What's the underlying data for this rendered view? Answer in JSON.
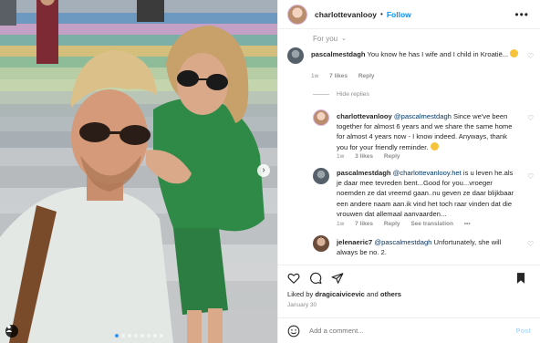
{
  "post": {
    "username": "charlottevanlooy",
    "separator": "•",
    "follow_label": "Follow",
    "more_label": "•••",
    "for_you_label": "For you",
    "image_alt": "selfie on colorful stairs",
    "carousel_dots": 8,
    "active_dot": 0
  },
  "comments": [
    {
      "username": "pascalmestdagh",
      "text": "You know he has I wife and I child in Kroatië...",
      "emoji": true,
      "time": "1w",
      "likes": "7 likes",
      "reply": "Reply"
    },
    {
      "username": "charlottevanlooy",
      "mention": "@pascalmestdagh",
      "text": "Since we've been together for almost 6 years and we share the same home for almost 4 years now - I know indeed. Anyways, thank you for your friendly reminder.",
      "emoji": true,
      "time": "1w",
      "likes": "3 likes",
      "reply": "Reply"
    },
    {
      "username": "pascalmestdagh",
      "mention": "@charlottevanlooy.het",
      "text": "is u leven he.als je daar mee tevreden bent...Good for you...vroeger noemden ze dat vreemd gaan..nu geven ze daar blijkbaar een andere naam aan.ik vind het toch raar vinden dat die vrouwen dat allemaal aanvaarden...",
      "time": "1w",
      "likes": "7 likes",
      "reply": "Reply",
      "translation": "See translation",
      "more": "•••"
    },
    {
      "username": "jelenaeric7",
      "mention": "@pascalmestdagh",
      "text": "Unfortunately, she will always be no. 2."
    }
  ],
  "hide_replies_label": "Hide replies",
  "liked_by": {
    "prefix": "Liked by",
    "user": "dragicaivicevic",
    "and": "and",
    "others": "others"
  },
  "date": "January 30",
  "add_comment": {
    "placeholder": "Add a comment...",
    "post_label": "Post"
  },
  "colors": {
    "accent": "#0095f6",
    "mention": "#00376b",
    "muted": "#8e8e8e"
  }
}
